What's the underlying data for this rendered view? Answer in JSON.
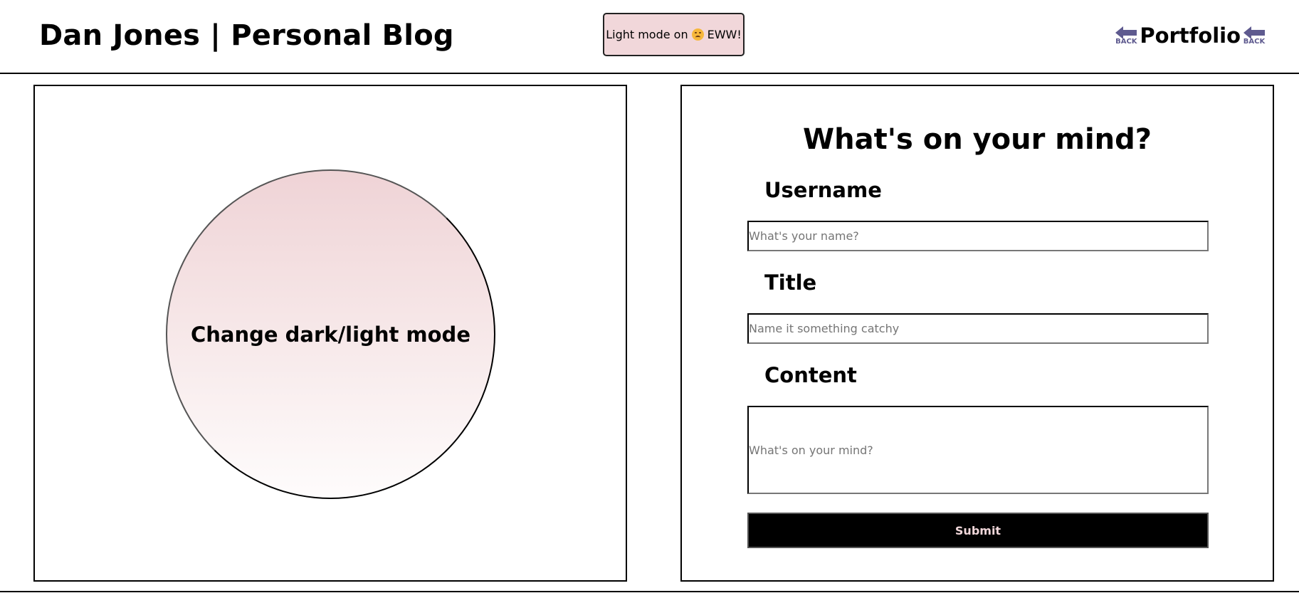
{
  "header": {
    "site_title": "Dan Jones | Personal Blog",
    "mode_toggle": {
      "text_before": "Light mode on",
      "emoji_icon": "disappointed-face-icon",
      "text_after": "EWW!",
      "background_color": "#f1d7da"
    },
    "portfolio_link": {
      "label": "Portfolio",
      "back_badge_text": "BACK",
      "back_badge_icon": "back-arrow-icon",
      "back_badge_color": "#5e5a8f"
    }
  },
  "mode_panel": {
    "circle_label": "Change dark/light mode"
  },
  "form": {
    "heading": "What's on your mind?",
    "username": {
      "label": "Username",
      "placeholder": "What's your name?"
    },
    "title": {
      "label": "Title",
      "placeholder": "Name it something catchy"
    },
    "content": {
      "label": "Content",
      "placeholder": "What's on your mind?"
    },
    "submit_label": "Submit"
  }
}
